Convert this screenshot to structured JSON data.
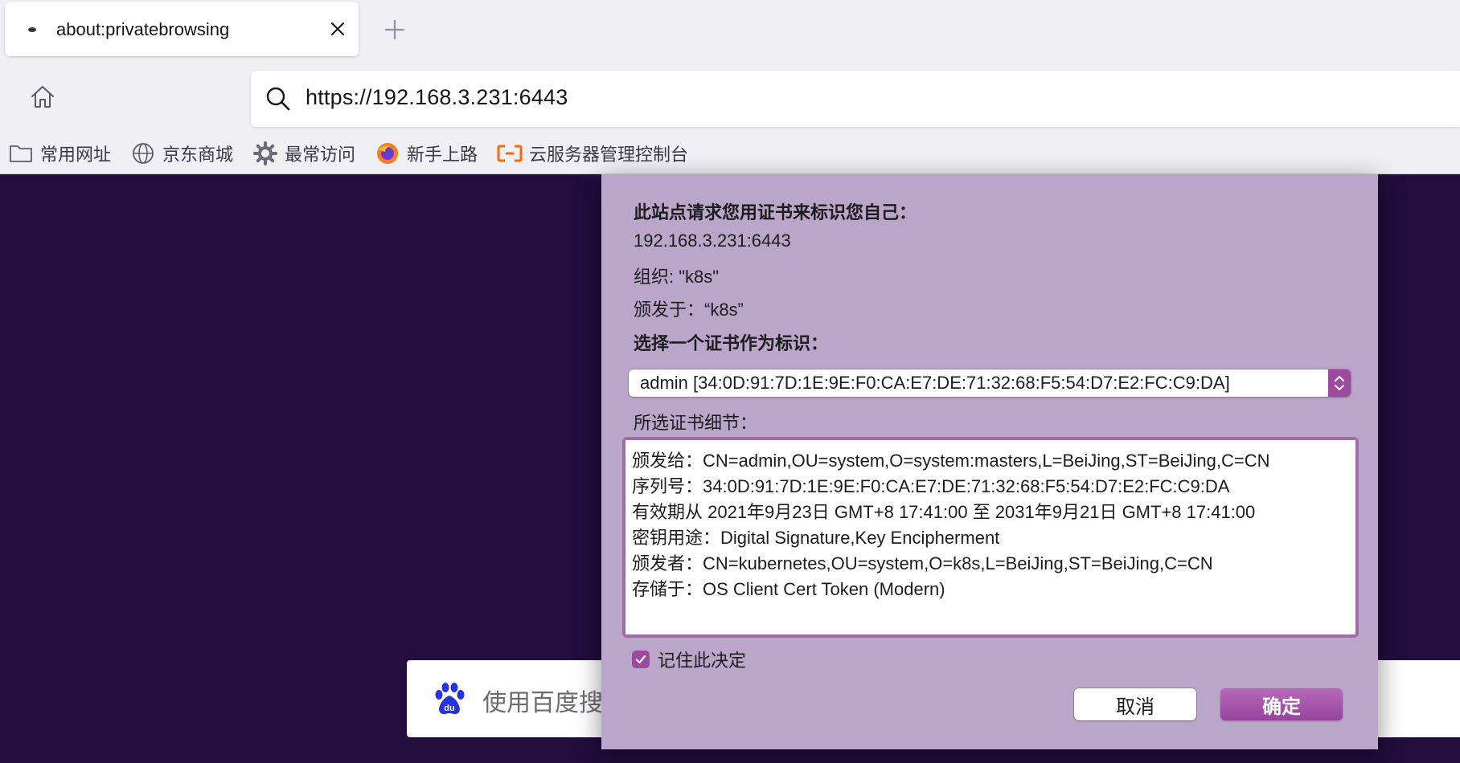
{
  "tab": {
    "title": "about:privatebrowsing"
  },
  "url_bar": {
    "url": "https://192.168.3.231:6443"
  },
  "bookmarks": [
    {
      "label": "常用网址",
      "icon": "folder-icon"
    },
    {
      "label": "京东商城",
      "icon": "globe-icon"
    },
    {
      "label": "最常访问",
      "icon": "gear-icon"
    },
    {
      "label": "新手上路",
      "icon": "firefox-icon"
    },
    {
      "label": "云服务器管理控制台",
      "icon": "aliyun-icon"
    }
  ],
  "page": {
    "search_placeholder": "使用百度搜"
  },
  "dialog": {
    "heading": "此站点请求您用证书来标识您自己：",
    "host": "192.168.3.231:6443",
    "organization": "组织: \"k8s\"",
    "issued_under": "颁发于：“k8s”",
    "choose_label": "选择一个证书作为标识：",
    "selected_cert": "admin [34:0D:91:7D:1E:9E:F0:CA:E7:DE:71:32:68:F5:54:D7:E2:FC:C9:DA]",
    "details_label": "所选证书细节：",
    "details": [
      "颁发给：CN=admin,OU=system,O=system:masters,L=BeiJing,ST=BeiJing,C=CN",
      "序列号：34:0D:91:7D:1E:9E:F0:CA:E7:DE:71:32:68:F5:54:D7:E2:FC:C9:DA",
      "有效期从 2021年9月23日 GMT+8 17:41:00 至 2031年9月21日 GMT+8 17:41:00",
      "密钥用途：Digital Signature,Key Encipherment",
      "颁发者：CN=kubernetes,OU=system,O=k8s,L=BeiJing,ST=BeiJing,C=CN",
      "存储于：OS Client Cert Token (Modern)"
    ],
    "remember_label": "记住此决定",
    "remember_checked": true,
    "cancel_label": "取消",
    "ok_label": "确定"
  },
  "colors": {
    "page_background": "#220d3e",
    "dialog_background": "#b9a6c9",
    "accent": "#9b4a9e"
  }
}
